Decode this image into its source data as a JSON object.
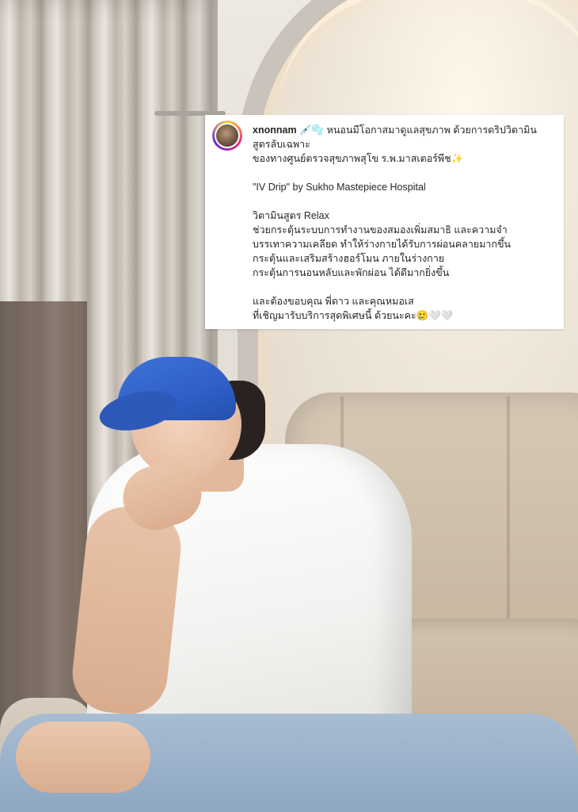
{
  "post": {
    "username": "xnonnam",
    "caption_line1": "💉🫧 หนอนมีโอกาสมาดูแลสุขภาพ ด้วยการดริปวิตามิน",
    "caption_line2": "สูตรลับเฉพาะ",
    "caption_line3": "ของทางศูนย์ตรวจสุขภาพสุโข ร.พ.มาสเตอร์พีช✨",
    "caption_line4": "\"IV Drip\" by Sukho Mastepiece Hospital",
    "caption_line5": "วิตามินสูตร Relax",
    "caption_line6": "ช่วยกระตุ้นระบบการทำงานของสมองเพิ่มสมาธิ และความจำ",
    "caption_line7": "บรรเทาความเคลียด ทำให้ร่างกายได้รับการผ่อนคลายมากขึ้น",
    "caption_line8": "กระตุ้นและเสริมสร้างฮอร์โมน ภายในร่างกาย",
    "caption_line9": "กระตุ้นการนอนหลับและพักผ่อน ได้ดีมากยิ่งขึ้น",
    "caption_line10": "และต้องขอบคุณ พี่ดาว และคุณหมอเส",
    "caption_line11": "ที่เชิญมารับบริการสุดพิเศษนี้ ด้วยนะคะ🥲🤍🤍"
  },
  "icons": {
    "avatar": "profile-avatar",
    "story_ring_colors": [
      "#f9ce34",
      "#ee2a7b",
      "#6228d7"
    ]
  }
}
